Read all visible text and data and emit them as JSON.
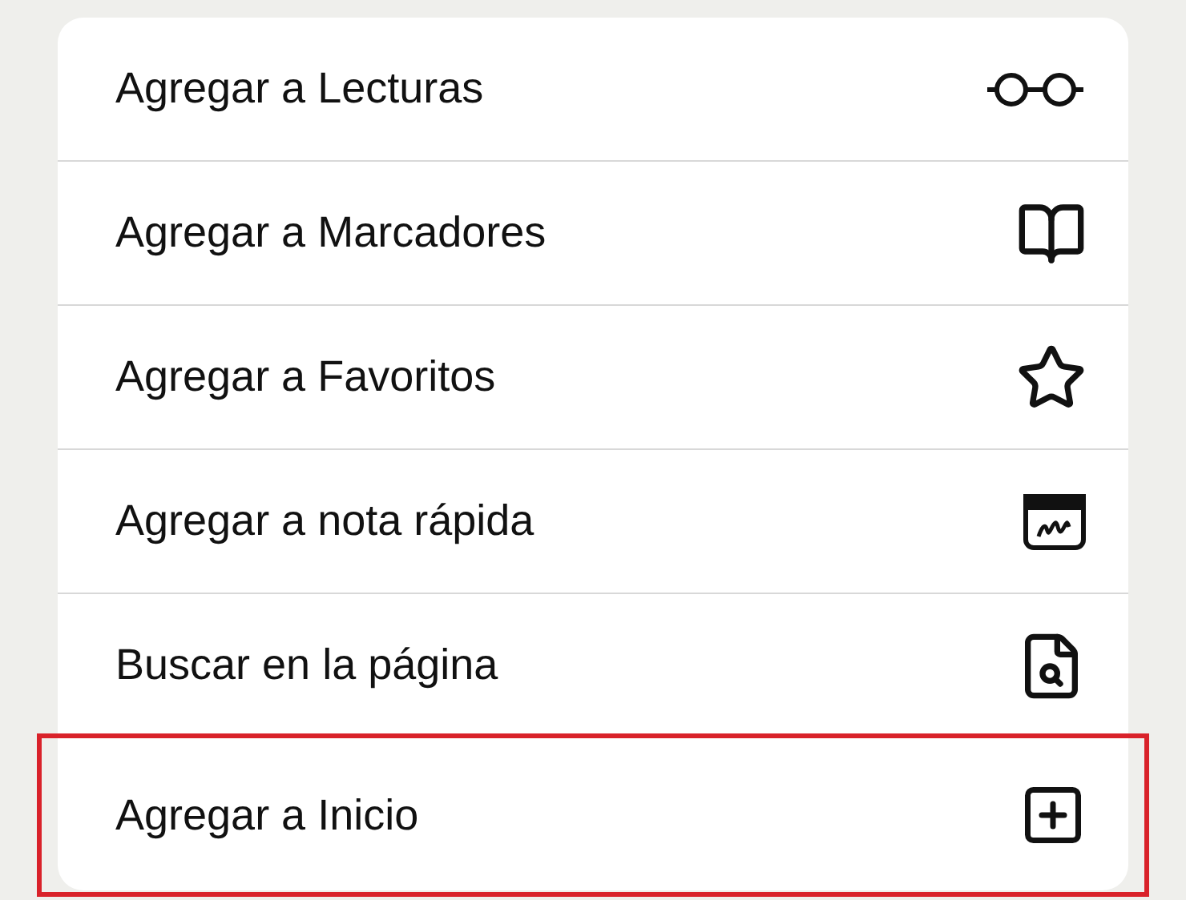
{
  "menu": {
    "items": [
      {
        "label": "Agregar a Lecturas",
        "highlighted": false
      },
      {
        "label": "Agregar a Marcadores",
        "highlighted": false
      },
      {
        "label": "Agregar a Favoritos",
        "highlighted": false
      },
      {
        "label": "Agregar a nota rápida",
        "highlighted": false
      },
      {
        "label": "Buscar en la página",
        "highlighted": false
      },
      {
        "label": "Agregar a Inicio",
        "highlighted": true
      }
    ]
  }
}
